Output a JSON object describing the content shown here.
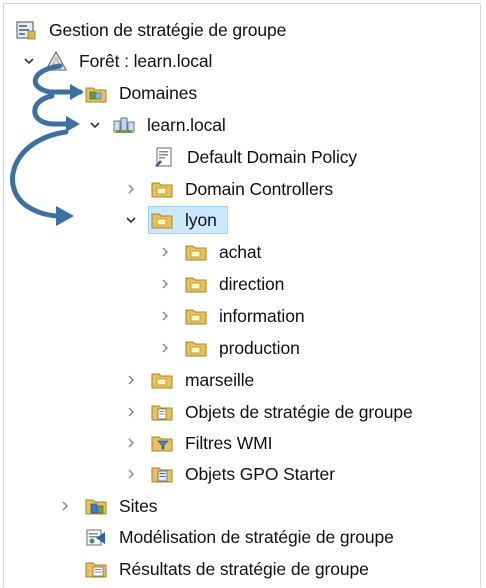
{
  "tree": {
    "root": {
      "label": "Gestion de stratégie de groupe",
      "icon": "gpmc-console-icon"
    },
    "forest": {
      "label": "Forêt : learn.local",
      "icon": "forest-icon",
      "expanded": true
    },
    "domains": {
      "label": "Domaines",
      "icon": "domains-folder-icon"
    },
    "domain": {
      "label": "learn.local",
      "icon": "domain-icon",
      "expanded": true
    },
    "default_policy": {
      "label": "Default Domain Policy",
      "icon": "gpo-link-icon"
    },
    "domain_controllers": {
      "label": "Domain Controllers",
      "icon": "ou-folder-icon"
    },
    "lyon": {
      "label": "lyon",
      "icon": "ou-folder-icon",
      "expanded": true,
      "selected": true
    },
    "lyon_children": [
      {
        "label": "achat",
        "icon": "ou-folder-icon"
      },
      {
        "label": "direction",
        "icon": "ou-folder-icon"
      },
      {
        "label": "information",
        "icon": "ou-folder-icon"
      },
      {
        "label": "production",
        "icon": "ou-folder-icon"
      }
    ],
    "marseille": {
      "label": "marseille",
      "icon": "ou-folder-icon"
    },
    "gpo_objects": {
      "label": "Objets de stratégie de groupe",
      "icon": "gpo-container-icon"
    },
    "wmi_filters": {
      "label": "Filtres WMI",
      "icon": "wmi-filter-icon"
    },
    "starter_gpos": {
      "label": "Objets GPO Starter",
      "icon": "starter-gpo-icon"
    },
    "sites": {
      "label": "Sites",
      "icon": "sites-icon"
    },
    "modeling": {
      "label": "Modélisation de stratégie de groupe",
      "icon": "modeling-icon"
    },
    "results": {
      "label": "Résultats de stratégie de groupe",
      "icon": "results-icon"
    }
  },
  "colors": {
    "arrow": "#3d6fa3",
    "selection_bg": "#cce8ff",
    "selection_border": "#99d1ff",
    "folder": "#e8c15a",
    "chevron": "#8a8a8a"
  }
}
